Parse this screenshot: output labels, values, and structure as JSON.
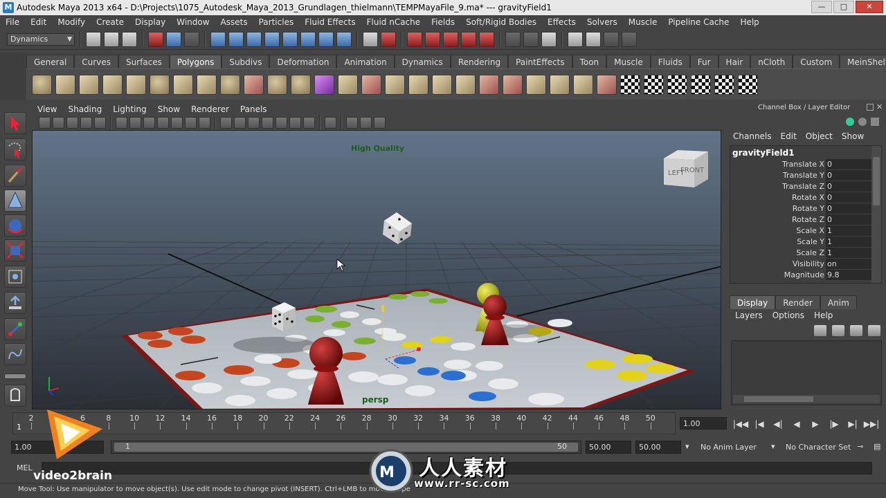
{
  "window": {
    "title": "Autodesk Maya 2013 x64 - D:\\Projects\\1075_Autodesk_Maya_2013_Grundlagen_thielmann\\TEMPMayaFile_9.ma*   ---   gravityField1",
    "minimize": "—",
    "maximize": "□",
    "close": "✕"
  },
  "menu": [
    "File",
    "Edit",
    "Modify",
    "Create",
    "Display",
    "Window",
    "Assets",
    "Particles",
    "Fluid Effects",
    "Fluid nCache",
    "Fields",
    "Soft/Rigid Bodies",
    "Effects",
    "Solvers",
    "Muscle",
    "Pipeline Cache",
    "Help"
  ],
  "statusline": {
    "menu_set": "Dynamics"
  },
  "shelf": {
    "tabs": [
      "General",
      "Curves",
      "Surfaces",
      "Polygons",
      "Subdivs",
      "Deformation",
      "Animation",
      "Dynamics",
      "Rendering",
      "PaintEffects",
      "Toon",
      "Muscle",
      "Fluids",
      "Fur",
      "Hair",
      "nCloth",
      "Custom",
      "MeinShelf"
    ],
    "active_tab": "Polygons"
  },
  "viewport": {
    "menu": [
      "View",
      "Shading",
      "Lighting",
      "Show",
      "Renderer",
      "Panels"
    ],
    "quality_label": "High Quality",
    "camera_label": "persp",
    "viewcube_label": "FRONT",
    "viewcube_side": "LEFT"
  },
  "channel_box": {
    "title": "Channel Box / Layer Editor",
    "menus": [
      "Channels",
      "Edit",
      "Object",
      "Show"
    ],
    "node": "gravityField1",
    "attributes": [
      {
        "label": "Translate X",
        "value": "0"
      },
      {
        "label": "Translate Y",
        "value": "0"
      },
      {
        "label": "Translate Z",
        "value": "0"
      },
      {
        "label": "Rotate X",
        "value": "0"
      },
      {
        "label": "Rotate Y",
        "value": "0"
      },
      {
        "label": "Rotate Z",
        "value": "0"
      },
      {
        "label": "Scale X",
        "value": "1"
      },
      {
        "label": "Scale Y",
        "value": "1"
      },
      {
        "label": "Scale Z",
        "value": "1"
      },
      {
        "label": "Visibility",
        "value": "on"
      },
      {
        "label": "Magnitude",
        "value": "9.8"
      }
    ]
  },
  "layer_editor": {
    "tabs": [
      "Display",
      "Render",
      "Anim"
    ],
    "active_tab": "Display",
    "menus": [
      "Layers",
      "Options",
      "Help"
    ]
  },
  "time_slider": {
    "ticks": [
      "2",
      "4",
      "6",
      "8",
      "10",
      "12",
      "14",
      "16",
      "18",
      "20",
      "22",
      "24",
      "26",
      "28",
      "30",
      "32",
      "34",
      "36",
      "38",
      "40",
      "42",
      "44",
      "46",
      "48",
      "50"
    ],
    "current_frame_marker": "1",
    "current_time": "1.00"
  },
  "range_slider": {
    "start_time": "1.00",
    "start_field": "1",
    "range_start_label": "1",
    "range_end_label": "50",
    "end_field": "50.00",
    "end_time": "50.00",
    "anim_layer": "No Anim Layer",
    "character_set": "No Character Set"
  },
  "command_line": {
    "label": "MEL"
  },
  "help_line": "Move Tool: Use manipulator to move object(s). Use edit mode to change pivot (INSERT).  Ctrl+LMB to move perpe",
  "watermarks": {
    "video2brain": "video2brain",
    "rr_title": "人人素材",
    "rr_url": "www.rr-sc.com"
  }
}
